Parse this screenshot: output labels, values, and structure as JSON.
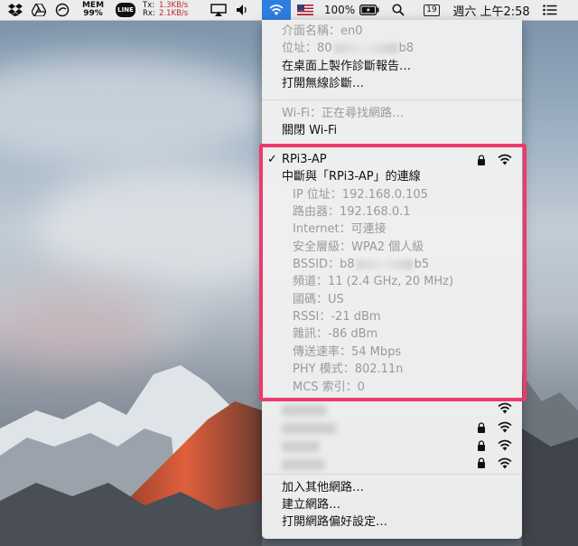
{
  "menubar": {
    "mem_label": "MEM",
    "mem_value": "99%",
    "tx_label": "Tx:",
    "tx_value": "1.3KB/s",
    "rx_label": "Rx:",
    "rx_value": "2.1KB/s",
    "line_label": "LINE",
    "battery_percent": "100%",
    "calendar_day": "19",
    "clock": "週六 上午2:58"
  },
  "wifi_menu": {
    "interface_name": "介面名稱：en0",
    "address_prefix": "位址：80",
    "address_suffix": "b8",
    "create_report": "在桌面上製作診斷報告…",
    "open_wireless_diag": "打開無線診斷…",
    "wifi_status": "Wi-Fi：正在尋找網路…",
    "turn_off_wifi": "關閉 Wi-Fi",
    "connected_network": {
      "checkmark": "✓",
      "name": "RPi3-AP",
      "disconnect": "中斷與「RPi3-AP」的連線",
      "ip": "IP 位址：192.168.0.105",
      "router": "路由器：192.168.0.1",
      "internet": "Internet：可連接",
      "security": "安全層級：WPA2 個人級",
      "bssid_prefix": "BSSID：b8",
      "bssid_suffix": "b5",
      "channel": "頻道：11 (2.4 GHz, 20 MHz)",
      "country": "國碼：US",
      "rssi": "RSSI：-21 dBm",
      "noise": "雜訊：-86 dBm",
      "tx_rate": "傳送速率：54 Mbps",
      "phy_mode": "PHY 模式：802.11n",
      "mcs_index": "MCS 索引：0"
    },
    "join_other": "加入其他網路…",
    "create_network": "建立網路…",
    "open_prefs": "打開網路偏好設定…"
  },
  "colors": {
    "highlight": "#ee3a6a",
    "menubar_active": "#2f7de1",
    "net_value": "#c0282a"
  }
}
